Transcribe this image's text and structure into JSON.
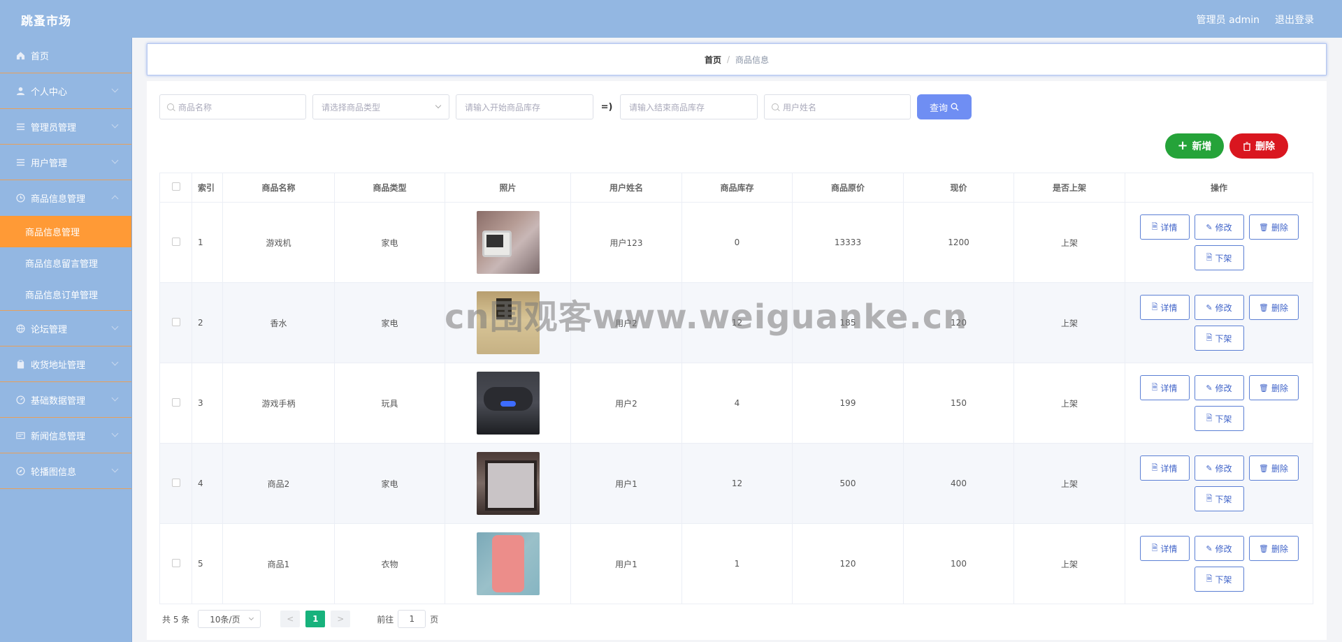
{
  "header": {
    "brand": "跳蚤市场",
    "user_label": "管理员 admin",
    "logout_label": "退出登录"
  },
  "sidebar": {
    "items": [
      {
        "label": "首页",
        "icon": "home-icon"
      },
      {
        "label": "个人中心",
        "icon": "user-icon"
      },
      {
        "label": "管理员管理",
        "icon": "list-icon"
      },
      {
        "label": "用户管理",
        "icon": "list-icon"
      },
      {
        "label": "商品信息管理",
        "icon": "clock-icon"
      }
    ],
    "submenu": [
      {
        "label": "商品信息管理",
        "active": true
      },
      {
        "label": "商品信息留言管理",
        "active": false
      },
      {
        "label": "商品信息订单管理",
        "active": false
      }
    ],
    "items_after": [
      {
        "label": "论坛管理",
        "icon": "globe-icon"
      },
      {
        "label": "收货地址管理",
        "icon": "clipboard-icon"
      },
      {
        "label": "基础数据管理",
        "icon": "gauge-icon"
      },
      {
        "label": "新闻信息管理",
        "icon": "newspaper-icon"
      },
      {
        "label": "轮播图信息",
        "icon": "compass-icon"
      }
    ]
  },
  "breadcrumb": {
    "home": "首页",
    "separator": "/",
    "current": "商品信息"
  },
  "search": {
    "name_placeholder": "商品名称",
    "type_placeholder": "请选择商品类型",
    "stock_start_placeholder": "请输入开始商品库存",
    "range_symbol": "=)",
    "stock_end_placeholder": "请输入结束商品库存",
    "user_placeholder": "用户姓名",
    "query_label": "查询"
  },
  "actions": {
    "add_label": "新增",
    "delete_label": "删除"
  },
  "table": {
    "headers": [
      "",
      "索引",
      "商品名称",
      "商品类型",
      "照片",
      "用户姓名",
      "商品库存",
      "商品原价",
      "现价",
      "是否上架",
      "操作"
    ],
    "rows": [
      {
        "index": "1",
        "name": "游戏机",
        "type": "家电",
        "user": "用户123",
        "stock": "0",
        "orig_price": "13333",
        "price": "1200",
        "status": "上架"
      },
      {
        "index": "2",
        "name": "香水",
        "type": "家电",
        "user": "用户2",
        "stock": "12",
        "orig_price": "185",
        "price": "120",
        "status": "上架"
      },
      {
        "index": "3",
        "name": "游戏手柄",
        "type": "玩具",
        "user": "用户2",
        "stock": "4",
        "orig_price": "199",
        "price": "150",
        "status": "上架"
      },
      {
        "index": "4",
        "name": "商品2",
        "type": "家电",
        "user": "用户1",
        "stock": "12",
        "orig_price": "500",
        "price": "400",
        "status": "上架"
      },
      {
        "index": "5",
        "name": "商品1",
        "type": "衣物",
        "user": "用户1",
        "stock": "1",
        "orig_price": "120",
        "price": "100",
        "status": "上架"
      }
    ],
    "op_labels": {
      "detail": "详情",
      "edit": "修改",
      "delete": "删除",
      "offshelf": "下架"
    }
  },
  "pagination": {
    "total": "共 5 条",
    "page_size": "10条/页",
    "prev": "<",
    "current_page": "1",
    "next": ">",
    "goto_label": "前往",
    "goto_value": "1",
    "page_unit": "页"
  },
  "watermark": "cn围观客www.weiguanke.cn",
  "colors": {
    "header_bg": "#93b7e2",
    "active_menu": "#ff9a36",
    "query_button": "#6f8ef3",
    "add_button": "#25a339",
    "delete_button": "#d9161f",
    "current_page": "#17b27c"
  }
}
